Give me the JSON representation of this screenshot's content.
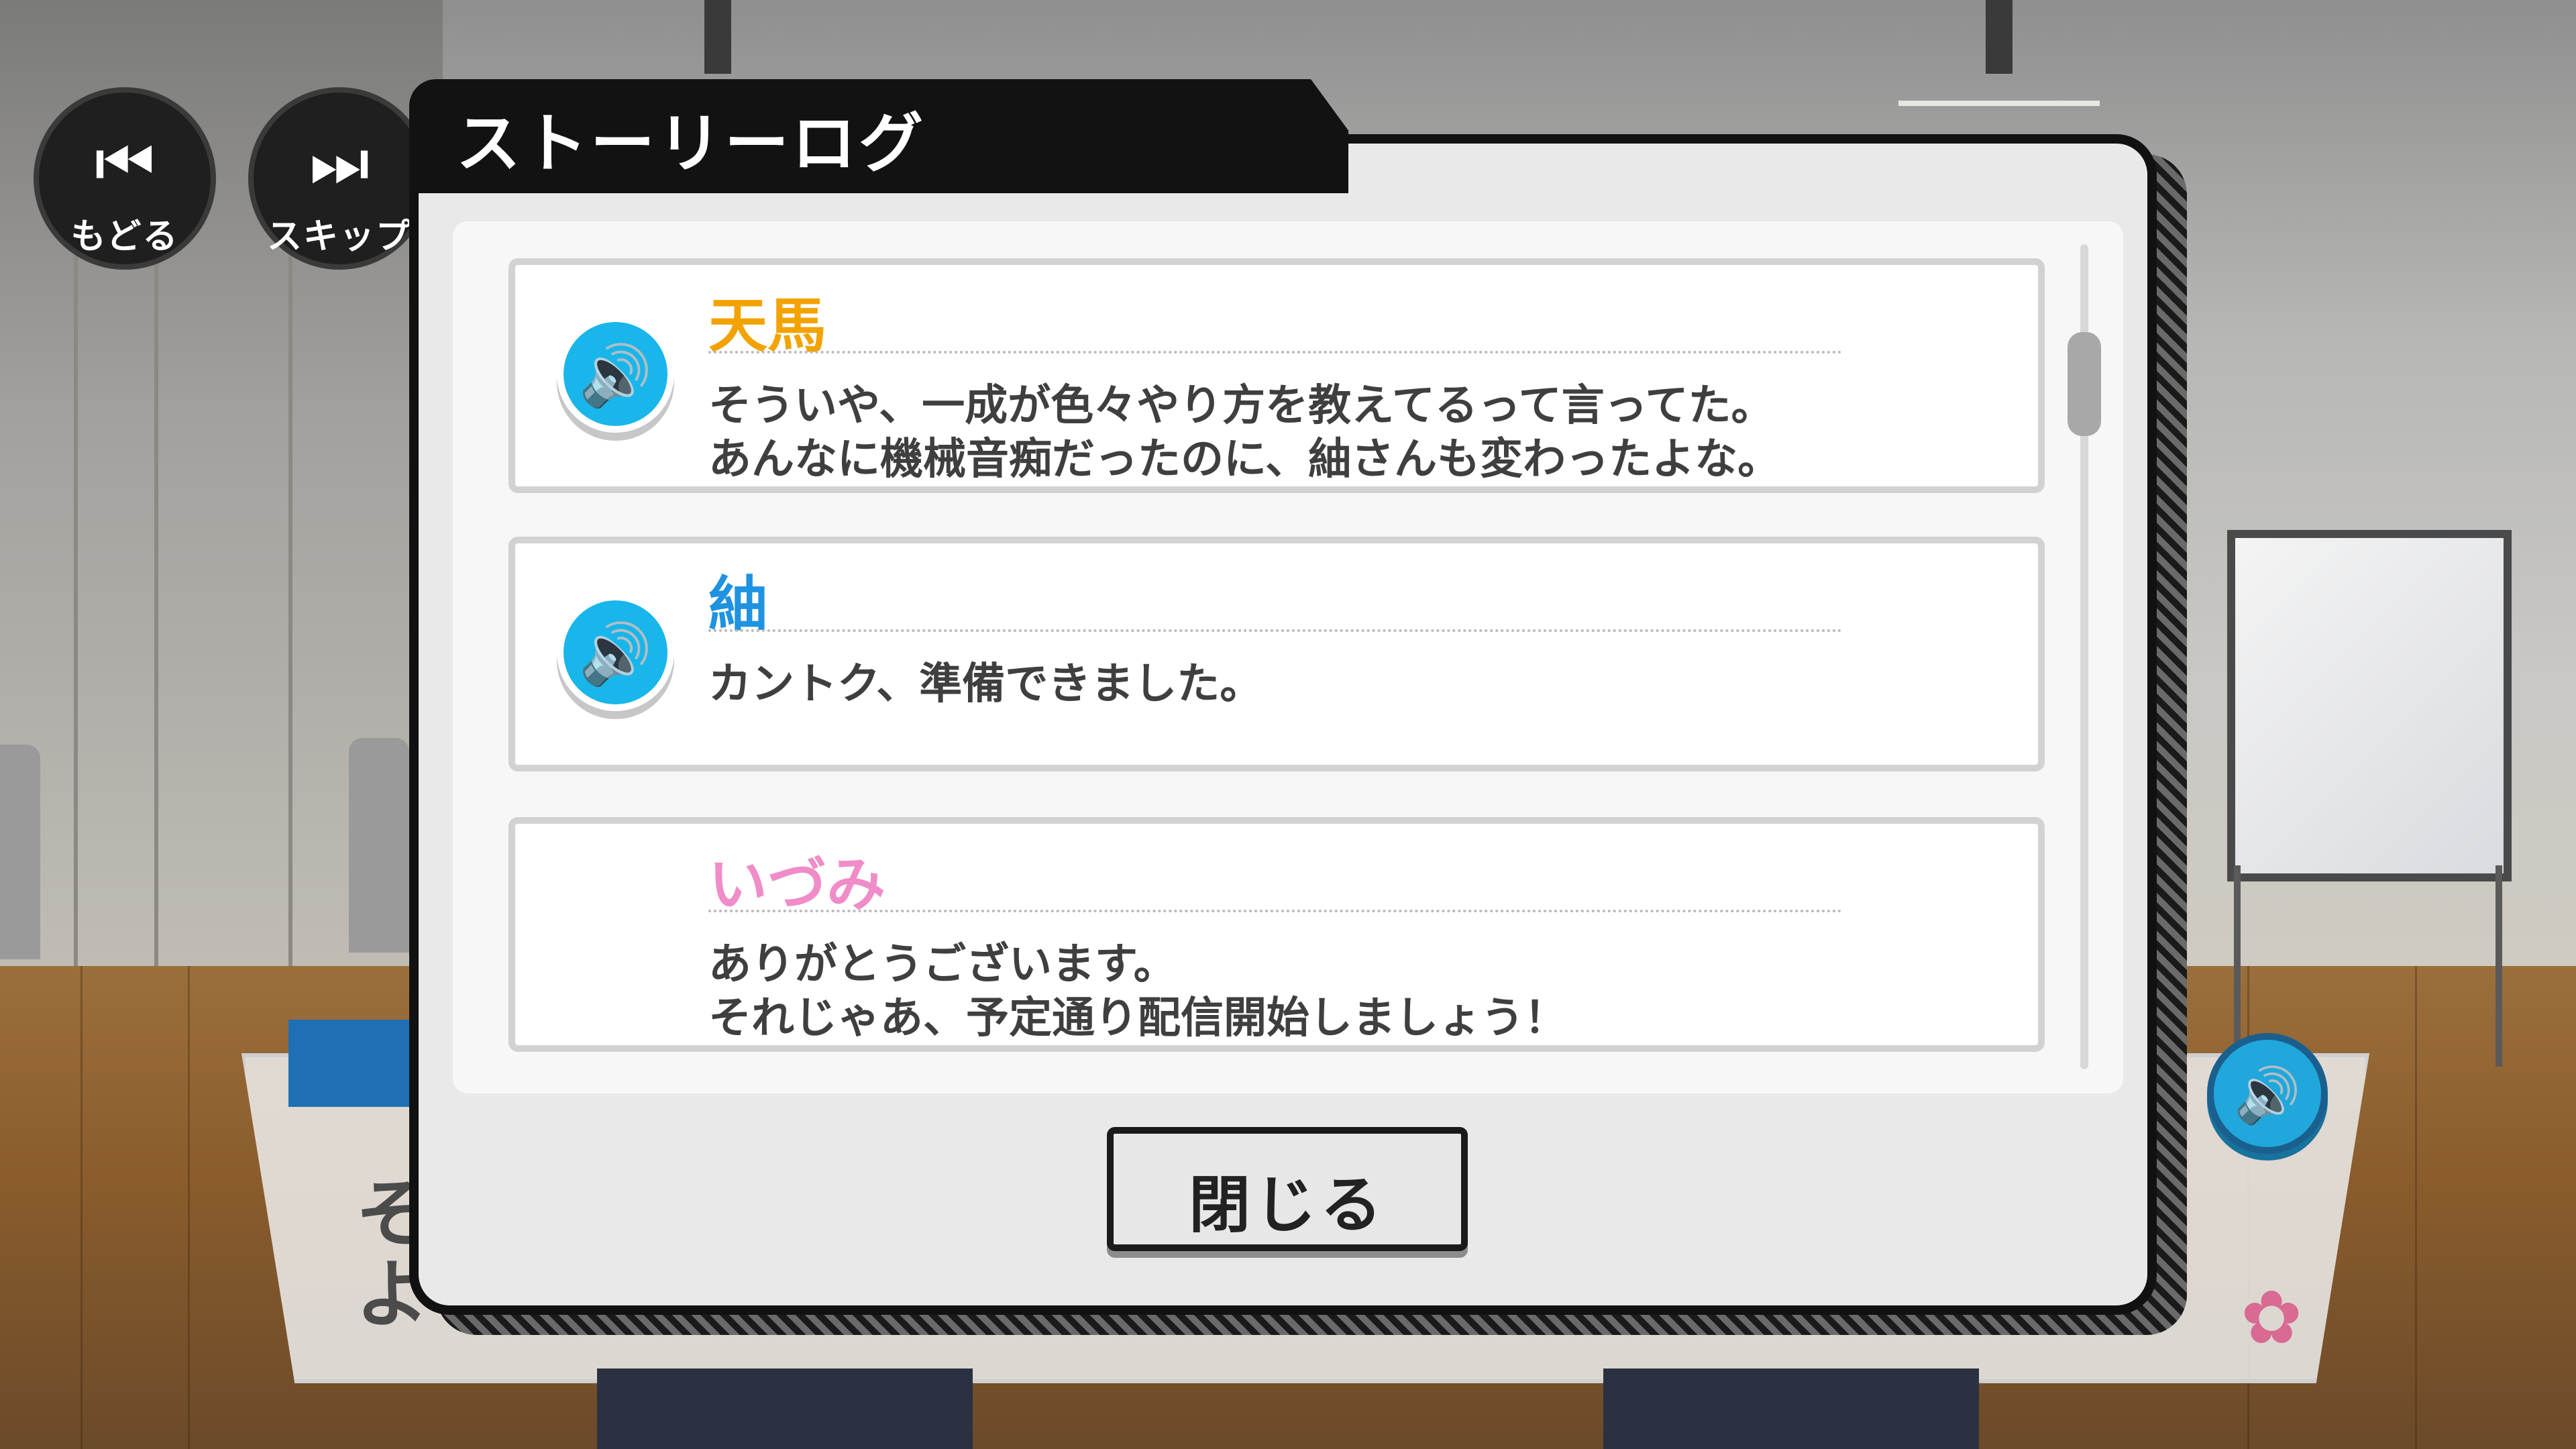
{
  "controls": {
    "back_label": "もどる",
    "skip_label": "スキップ",
    "back_icon": "rewind-icon",
    "skip_icon": "skip-icon"
  },
  "modal": {
    "title": "ストーリーログ",
    "close_label": "閉じる",
    "entries": [
      {
        "speaker": "天馬",
        "speaker_color": "#f2a300",
        "has_voice": true,
        "line1": "そういや、一成が色々やり方を教えてるって言ってた。",
        "line2": "あんなに機械音痴だったのに、紬さんも変わったよな。"
      },
      {
        "speaker": "紬",
        "speaker_color": "#1f93e0",
        "has_voice": true,
        "line1": "カントク、準備できました。",
        "line2": ""
      },
      {
        "speaker": "いづみ",
        "speaker_color": "#f08cc8",
        "has_voice": false,
        "line1": "ありがとうございます。",
        "line2": "それじゃあ、予定通り配信開始しましょう！"
      }
    ]
  },
  "dialog_behind": {
    "line1_char": "そ",
    "line2_char": "よ"
  },
  "icons": {
    "voice": "speaker-icon",
    "sakura": "sakura-icon"
  },
  "colors": {
    "voice_blue": "#18b6ea",
    "modal_bg": "#e9e9e9",
    "frame": "#111111"
  }
}
